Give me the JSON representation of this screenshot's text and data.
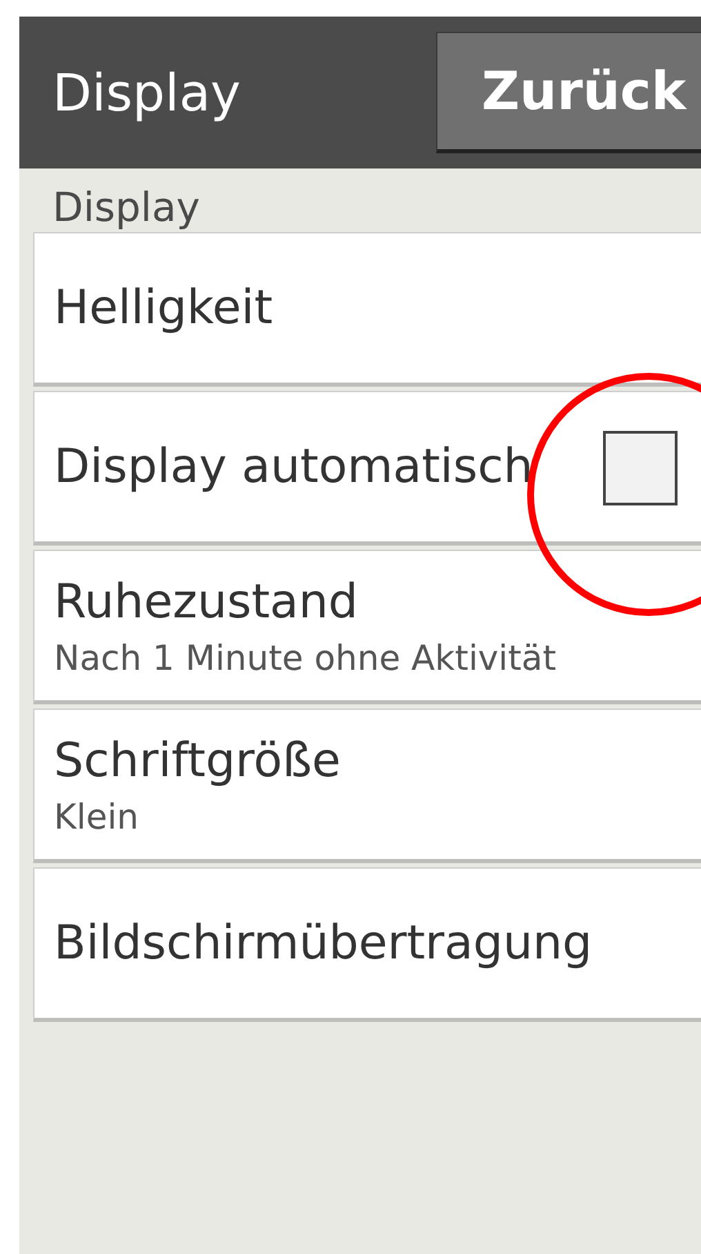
{
  "header": {
    "title": "Display",
    "back_button": "Zurück"
  },
  "section": {
    "label": "Display"
  },
  "items": [
    {
      "kind": "plain",
      "title": "Helligkeit"
    },
    {
      "kind": "checkbox",
      "title": "Display automatisch",
      "checked": false
    },
    {
      "kind": "subtitle",
      "title": "Ruhezustand",
      "subtitle": "Nach 1 Minute ohne Aktivität"
    },
    {
      "kind": "subtitle",
      "title": "Schriftgröße",
      "subtitle": "Klein"
    },
    {
      "kind": "plain",
      "title": "Bildschirmübertragung"
    }
  ]
}
